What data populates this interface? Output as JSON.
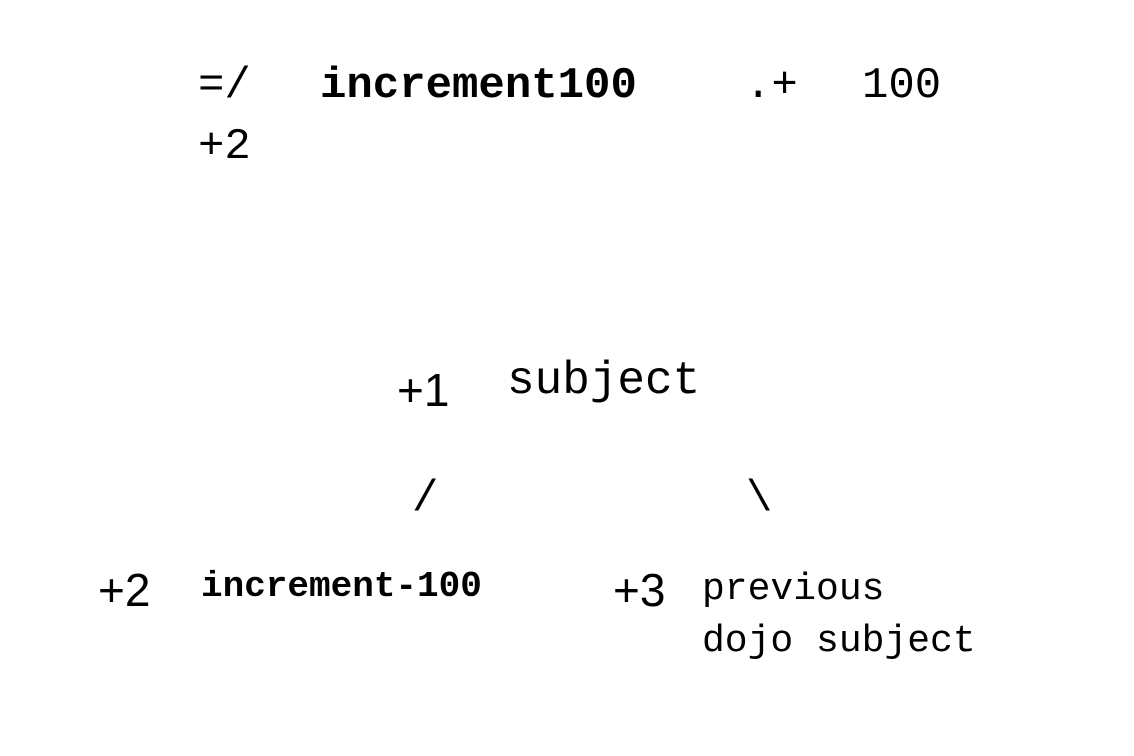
{
  "code": {
    "operator": "=/",
    "name": "increment100",
    "increment": ".+",
    "value": "100",
    "axis": "+2"
  },
  "tree": {
    "root": {
      "axis": "+1",
      "label": "subject"
    },
    "branch_left": "/",
    "branch_right": "\\",
    "left": {
      "axis": "+2",
      "label": "increment-100"
    },
    "right": {
      "axis": "+3",
      "label_line1": "previous",
      "label_line2": "dojo subject"
    }
  }
}
